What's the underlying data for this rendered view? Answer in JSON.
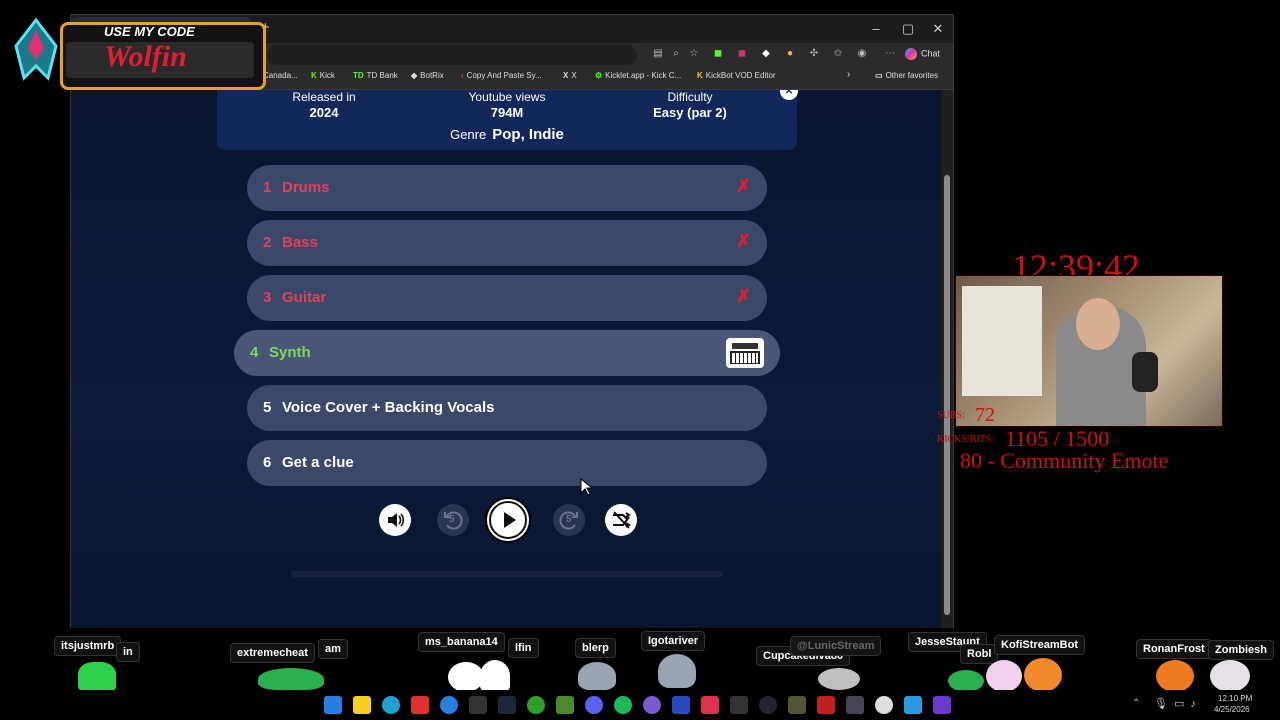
{
  "overlay": {
    "promo_line": "USE MY CODE",
    "promo_name": "Wolfin",
    "clock": "12:39:42",
    "subs_label": "SUBS:",
    "subs_value": "72",
    "kicks_label": "KICKS/BITS:",
    "kicks_value": "1105 / 1500",
    "goal_text": "80 - Community Emote"
  },
  "browser": {
    "new_tab_symbol": "+",
    "copilot_label": "Chat",
    "bookmarks": [
      {
        "icon": "K",
        "label": "Canada..."
      },
      {
        "icon": "K",
        "label": "Kick"
      },
      {
        "icon": "TD",
        "label": "TD Bank"
      },
      {
        "icon": "◆",
        "label": "BotRix"
      },
      {
        "icon": "‹",
        "label": "Copy And Paste Sy..."
      },
      {
        "icon": "X",
        "label": "X"
      },
      {
        "icon": "⚙",
        "label": "Kicklet.app - Kick C..."
      },
      {
        "icon": "K",
        "label": "KickBot VOD Editor"
      }
    ],
    "other_favorites": "Other favorites"
  },
  "song_info": {
    "released_label": "Released in",
    "released_value": "2024",
    "views_label": "Youtube views",
    "views_value": "794M",
    "difficulty_label": "Difficulty",
    "difficulty_value": "Easy (par 2)",
    "genre_label": "Genre",
    "genre_value": "Pop, Indie"
  },
  "tracks": [
    {
      "num": "1",
      "name": "Drums",
      "state": "wrong",
      "mark": "✗"
    },
    {
      "num": "2",
      "name": "Bass",
      "state": "wrong",
      "mark": "✗"
    },
    {
      "num": "3",
      "name": "Guitar",
      "state": "wrong",
      "mark": "✗"
    },
    {
      "num": "4",
      "name": "Synth",
      "state": "current"
    },
    {
      "num": "5",
      "name": "Voice Cover + Backing Vocals",
      "state": "plain"
    },
    {
      "num": "6",
      "name": "Get a clue",
      "state": "plain"
    }
  ],
  "controls": {
    "rewind_label": "5",
    "forward_label": "5"
  },
  "chatters": [
    {
      "name": "itsjustmrb"
    },
    {
      "name": "in"
    },
    {
      "name": "extremecheat"
    },
    {
      "name": "am"
    },
    {
      "name": "ms_banana14"
    },
    {
      "name": "lfin"
    },
    {
      "name": "blerp"
    },
    {
      "name": "Igotariver"
    },
    {
      "name": "Cupcakediva80"
    },
    {
      "name": "@LunicStream"
    },
    {
      "name": "JesseStaunt"
    },
    {
      "name": "Robl"
    },
    {
      "name": "KofiStreamBot"
    },
    {
      "name": "RonanFrost"
    },
    {
      "name": "Zombiesh"
    }
  ],
  "taskbar": {
    "time": "12:10 PM",
    "date": "4/25/2026"
  }
}
